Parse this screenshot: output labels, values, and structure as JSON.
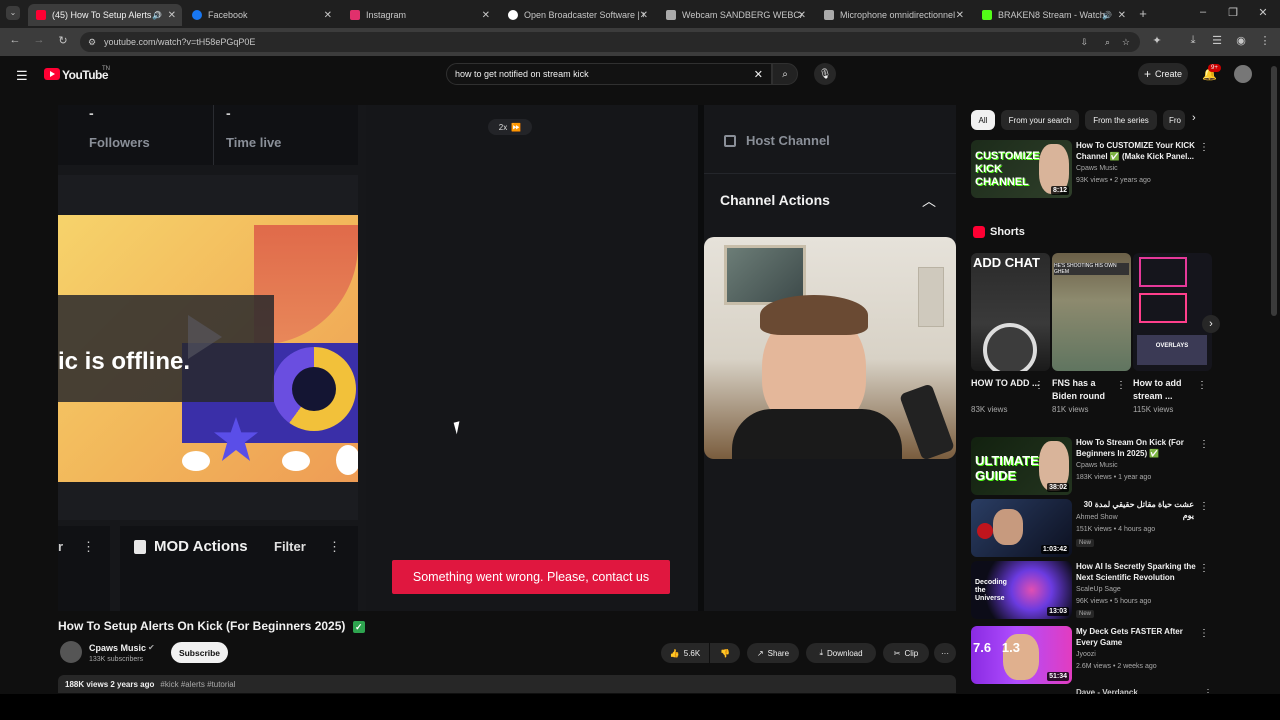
{
  "tabs": [
    {
      "label": "(45) How To Setup Alerts O",
      "color": "#ff0033",
      "active": true
    },
    {
      "label": "Facebook",
      "color": "#1877f2"
    },
    {
      "label": "Instagram",
      "color": "#e1306c"
    },
    {
      "label": "Open Broadcaster Software | O",
      "color": "#ffffff"
    },
    {
      "label": "Webcam SANDBERG WEBCAM",
      "color": "#aaaaaa"
    },
    {
      "label": "Microphone omnidirectionnel",
      "color": "#aaaaaa"
    },
    {
      "label": "BRAKEN8 Stream - Watch",
      "color": "#53fc18"
    }
  ],
  "toolbar": {
    "url": "youtube.com/watch?v=tH58ePGqP0E"
  },
  "header": {
    "logo_text": "YouTube",
    "logo_sup": "TN",
    "search_value": "how to get notified on stream kick",
    "create_label": "Create",
    "notif_count": "9+"
  },
  "video": {
    "stat1_value": "-",
    "stat1_label": "Followers",
    "stat2_value": "-",
    "stat2_label": "Time live",
    "offline_text": "ic is offline.",
    "speed_label": "2x",
    "host_channel": "Host Channel",
    "channel_actions": "Channel Actions",
    "mod_actions": "MOD Actions",
    "filter_label": "Filter",
    "error_text": "Something went wrong. Please, contact us"
  },
  "meta": {
    "title": "How To Setup Alerts On Kick (For Beginners 2025)",
    "channel": "Cpaws Music",
    "subscribers": "133K subscribers",
    "subscribe_label": "Subscribe",
    "likes": "5.6K",
    "share_label": "Share",
    "download_label": "Download",
    "clip_label": "Clip",
    "desc_stats": "188K views  2 years ago",
    "desc_tags": "#kick #alerts #tutorial"
  },
  "chips": [
    "All",
    "From your search",
    "From the series",
    "Fro"
  ],
  "shorts_title": "Shorts",
  "shorts": [
    {
      "title": "HOW TO ADD ...",
      "views": "83K views",
      "thumb_text": "ADD CHAT"
    },
    {
      "title": "FNS has a Biden round",
      "views": "81K views",
      "thumb_text": "HE'S SHOOTING HIS OWN GHEM"
    },
    {
      "title": "How to add stream ...",
      "views": "115K views",
      "thumb_text": "OVERLAYS"
    }
  ],
  "recs": [
    {
      "title": "How To CUSTOMIZE Your KICK Channel ✅ (Make Kick Panel...",
      "channel": "Cpaws Music",
      "meta": "93K views • 2 years ago",
      "duration": "8:12",
      "thumb_text": "CUSTOMIZE KICK CHANNEL"
    },
    {
      "title": "How To Stream On Kick (For Beginners In 2025) ✅",
      "channel": "Cpaws Music",
      "meta": "183K views • 1 year ago",
      "duration": "38:02",
      "thumb_text": "ULTIMATE GUIDE"
    },
    {
      "title": "عشت حياة مقاتل حقيقي لمدة 30 يوم",
      "channel": "Ahmed Show",
      "meta": "151K views • 4 hours ago",
      "duration": "1:03:42",
      "badge": "New"
    },
    {
      "title": "How AI Is Secretly Sparking the Next Scientific Revolution",
      "channel": "ScaleUp Sage",
      "meta": "96K views • 5 hours ago",
      "duration": "13:03",
      "badge": "New",
      "thumb_text": "Decoding the Universe"
    },
    {
      "title": "My Deck Gets FASTER After Every Game",
      "channel": "Jyoozi",
      "meta": "2.6M views • 2 weeks ago",
      "duration": "51:34",
      "thumb_text": "7.6   1.3"
    }
  ],
  "partial_rec": "Dave - Verdanck",
  "colors": {
    "accent": "#ff0033",
    "kick_green": "#53fc18",
    "error_red": "#e0173f"
  }
}
